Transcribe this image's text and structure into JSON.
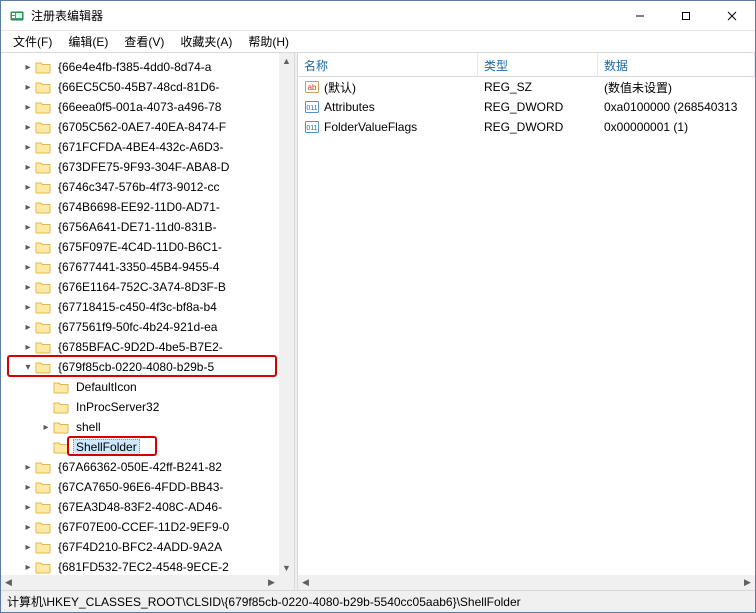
{
  "window": {
    "title": "注册表编辑器"
  },
  "menu": {
    "file": "文件(F)",
    "edit": "编辑(E)",
    "view": "查看(V)",
    "favorites": "收藏夹(A)",
    "help": "帮助(H)"
  },
  "tree": {
    "items": [
      {
        "depth": 3,
        "expander": "has",
        "label": "{66e4e4fb-f385-4dd0-8d74-a"
      },
      {
        "depth": 3,
        "expander": "has",
        "label": "{66EC5C50-45B7-48cd-81D6-"
      },
      {
        "depth": 3,
        "expander": "has",
        "label": "{66eea0f5-001a-4073-a496-78"
      },
      {
        "depth": 3,
        "expander": "has",
        "label": "{6705C562-0AE7-40EA-8474-F"
      },
      {
        "depth": 3,
        "expander": "has",
        "label": "{671FCFDA-4BE4-432c-A6D3-"
      },
      {
        "depth": 3,
        "expander": "has",
        "label": "{673DFE75-9F93-304F-ABA8-D"
      },
      {
        "depth": 3,
        "expander": "has",
        "label": "{6746c347-576b-4f73-9012-cc"
      },
      {
        "depth": 3,
        "expander": "has",
        "label": "{674B6698-EE92-11D0-AD71-"
      },
      {
        "depth": 3,
        "expander": "has",
        "label": "{6756A641-DE71-11d0-831B-"
      },
      {
        "depth": 3,
        "expander": "has",
        "label": "{675F097E-4C4D-11D0-B6C1-"
      },
      {
        "depth": 3,
        "expander": "has",
        "label": "{67677441-3350-45B4-9455-4"
      },
      {
        "depth": 3,
        "expander": "has",
        "label": "{676E1164-752C-3A74-8D3F-B"
      },
      {
        "depth": 3,
        "expander": "has",
        "label": "{67718415-c450-4f3c-bf8a-b4"
      },
      {
        "depth": 3,
        "expander": "has",
        "label": "{677561f9-50fc-4b24-921d-ea"
      },
      {
        "depth": 3,
        "expander": "has",
        "label": "{6785BFAC-9D2D-4be5-B7E2-"
      },
      {
        "depth": 3,
        "expander": "open",
        "label": "{679f85cb-0220-4080-b29b-5",
        "highlight": true
      },
      {
        "depth": 4,
        "expander": "",
        "label": "DefaultIcon"
      },
      {
        "depth": 4,
        "expander": "",
        "label": "InProcServer32"
      },
      {
        "depth": 4,
        "expander": "has",
        "label": "shell"
      },
      {
        "depth": 4,
        "expander": "",
        "label": "ShellFolder",
        "selected": true,
        "highlight": true
      },
      {
        "depth": 3,
        "expander": "has",
        "label": "{67A66362-050E-42ff-B241-82"
      },
      {
        "depth": 3,
        "expander": "has",
        "label": "{67CA7650-96E6-4FDD-BB43-"
      },
      {
        "depth": 3,
        "expander": "has",
        "label": "{67EA3D48-83F2-408C-AD46-"
      },
      {
        "depth": 3,
        "expander": "has",
        "label": "{67F07E00-CCEF-11D2-9EF9-0"
      },
      {
        "depth": 3,
        "expander": "has",
        "label": "{67F4D210-BFC2-4ADD-9A2A"
      },
      {
        "depth": 3,
        "expander": "has",
        "label": "{681FD532-7EC2-4548-9ECE-2"
      }
    ]
  },
  "list": {
    "columns": {
      "name": "名称",
      "type": "类型",
      "data": "数据"
    },
    "rows": [
      {
        "icon": "string",
        "name": "(默认)",
        "type": "REG_SZ",
        "data": "(数值未设置)"
      },
      {
        "icon": "binary",
        "name": "Attributes",
        "type": "REG_DWORD",
        "data": "0xa0100000 (268540313"
      },
      {
        "icon": "binary",
        "name": "FolderValueFlags",
        "type": "REG_DWORD",
        "data": "0x00000001 (1)"
      }
    ]
  },
  "status": {
    "path": "计算机\\HKEY_CLASSES_ROOT\\CLSID\\{679f85cb-0220-4080-b29b-5540cc05aab6}\\ShellFolder"
  },
  "colors": {
    "highlight_border": "#d40000",
    "selection": "#cde8ff",
    "link": "#186aa8"
  }
}
